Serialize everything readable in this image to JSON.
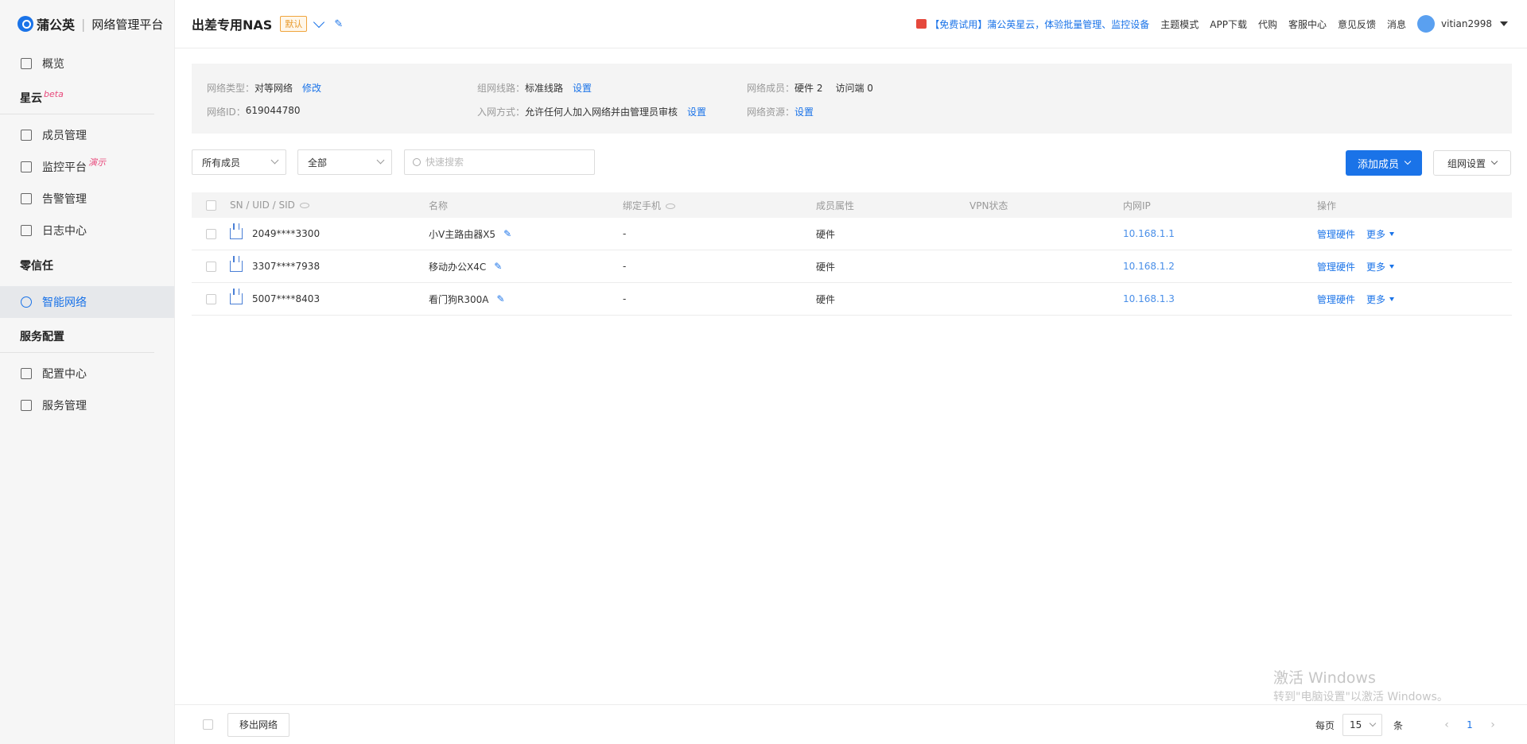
{
  "brand": {
    "name": "蒲公英",
    "platform": "网络管理平台"
  },
  "sidebar": {
    "overview": "概览",
    "groups": [
      {
        "title": "星云",
        "tag": "beta",
        "items": [
          {
            "label": "成员管理",
            "icon": "layers-icon"
          },
          {
            "label": "监控平台",
            "icon": "monitor-icon",
            "tag": "演示"
          },
          {
            "label": "告警管理",
            "icon": "bell-icon"
          },
          {
            "label": "日志中心",
            "icon": "log-icon"
          }
        ]
      },
      {
        "title": "零信任",
        "tag": "",
        "items": [
          {
            "label": "智能网络",
            "icon": "network-icon",
            "active": true
          }
        ]
      },
      {
        "title": "服务配置",
        "tag": "",
        "items": [
          {
            "label": "配置中心",
            "icon": "grid-icon"
          },
          {
            "label": "服务管理",
            "icon": "doc-icon"
          }
        ]
      }
    ]
  },
  "header": {
    "network_name": "出差专用NAS",
    "default_badge": "默认",
    "promo": "【免费试用】蒲公英星云，体验批量管理、监控设备",
    "links": [
      "主题模式",
      "APP下载",
      "代购",
      "客服中心",
      "意见反馈",
      "消息"
    ],
    "username": "vitian2998"
  },
  "info": {
    "type_label": "网络类型：",
    "type_value": "对等网络",
    "type_link": "修改",
    "id_label": "网络ID：",
    "id_value": "619044780",
    "line_label": "组网线路：",
    "line_value": "标准线路",
    "line_link": "设置",
    "join_label": "入网方式：",
    "join_value": "允许任何人加入网络并由管理员审核",
    "join_link": "设置",
    "members_label": "网络成员：",
    "members_value": "硬件 2",
    "visitors_value": "访问端 0",
    "resource_label": "网络资源：",
    "resource_link": "设置"
  },
  "filters": {
    "member_filter": "所有成员",
    "status_filter": "全部",
    "search_placeholder": "快速搜索",
    "add_member": "添加成员",
    "network_settings": "组网设置"
  },
  "table": {
    "headers": [
      "SN / UID / SID",
      "名称",
      "绑定手机",
      "成员属性",
      "VPN状态",
      "内网IP",
      "操作"
    ],
    "rows": [
      {
        "sn": "2049****3300",
        "name": "小V主路由器X5",
        "phone": "-",
        "attr": "硬件",
        "vpn": true,
        "ip": "10.168.1.1",
        "manage": "管理硬件",
        "more": "更多"
      },
      {
        "sn": "3307****7938",
        "name": "移动办公X4C",
        "phone": "-",
        "attr": "硬件",
        "vpn": true,
        "ip": "10.168.1.2",
        "manage": "管理硬件",
        "more": "更多"
      },
      {
        "sn": "5007****8403",
        "name": "看门狗R300A",
        "phone": "-",
        "attr": "硬件",
        "vpn": true,
        "ip": "10.168.1.3",
        "manage": "管理硬件",
        "more": "更多"
      }
    ]
  },
  "watermark": {
    "line1": "激活 Windows",
    "line2": "转到\"电脑设置\"以激活 Windows。"
  },
  "footer": {
    "remove": "移出网络",
    "per_page_label": "每页",
    "per_page": "15",
    "unit": "条",
    "current_page": "1"
  }
}
